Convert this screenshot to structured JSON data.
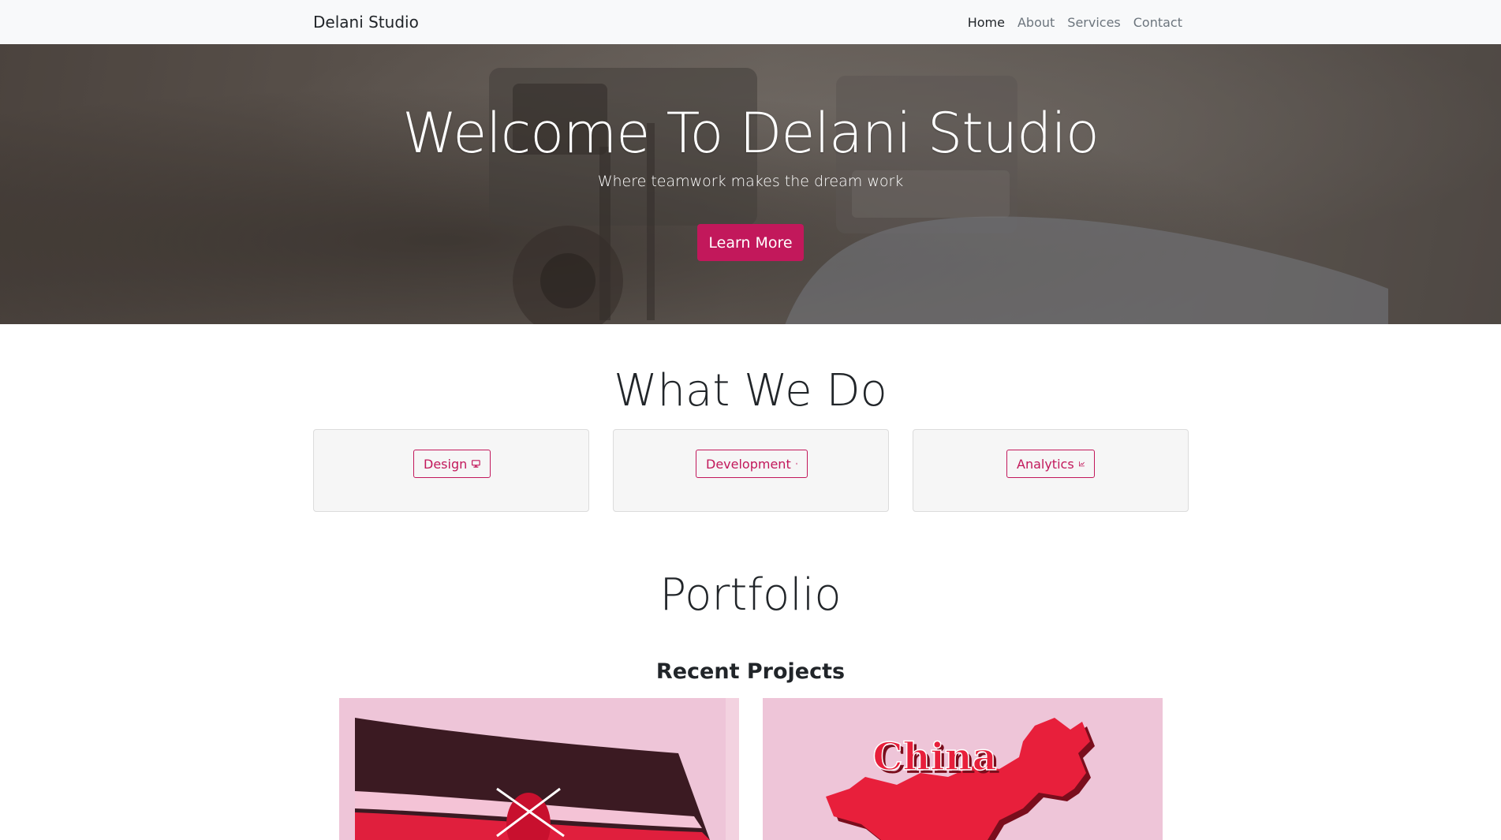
{
  "navbar": {
    "brand": "Delani Studio",
    "links": [
      {
        "label": "Home",
        "active": true
      },
      {
        "label": "About",
        "active": false
      },
      {
        "label": "Services",
        "active": false
      },
      {
        "label": "Contact",
        "active": false
      }
    ]
  },
  "hero": {
    "title": "Welcome To Delani Studio",
    "subtitle": "Where teamwork makes the dream work",
    "button_label": "Learn More"
  },
  "what_we_do": {
    "title": "What We Do",
    "services": [
      {
        "label": "Design",
        "icon": "desktop-icon"
      },
      {
        "label": "Development",
        "icon": "css3-icon"
      },
      {
        "label": "Analytics",
        "icon": "chart-line-icon"
      }
    ]
  },
  "portfolio": {
    "title": "Portfolio",
    "subtitle": "Recent Projects",
    "projects": [
      {
        "image": "kenya-flag-image"
      },
      {
        "image": "china-map-image",
        "caption": "China"
      }
    ]
  },
  "colors": {
    "accent": "#c2185b",
    "navbar_bg": "#f8f9fa",
    "card_bg": "#f6f6f6",
    "project_bg": "#eec5d8"
  }
}
